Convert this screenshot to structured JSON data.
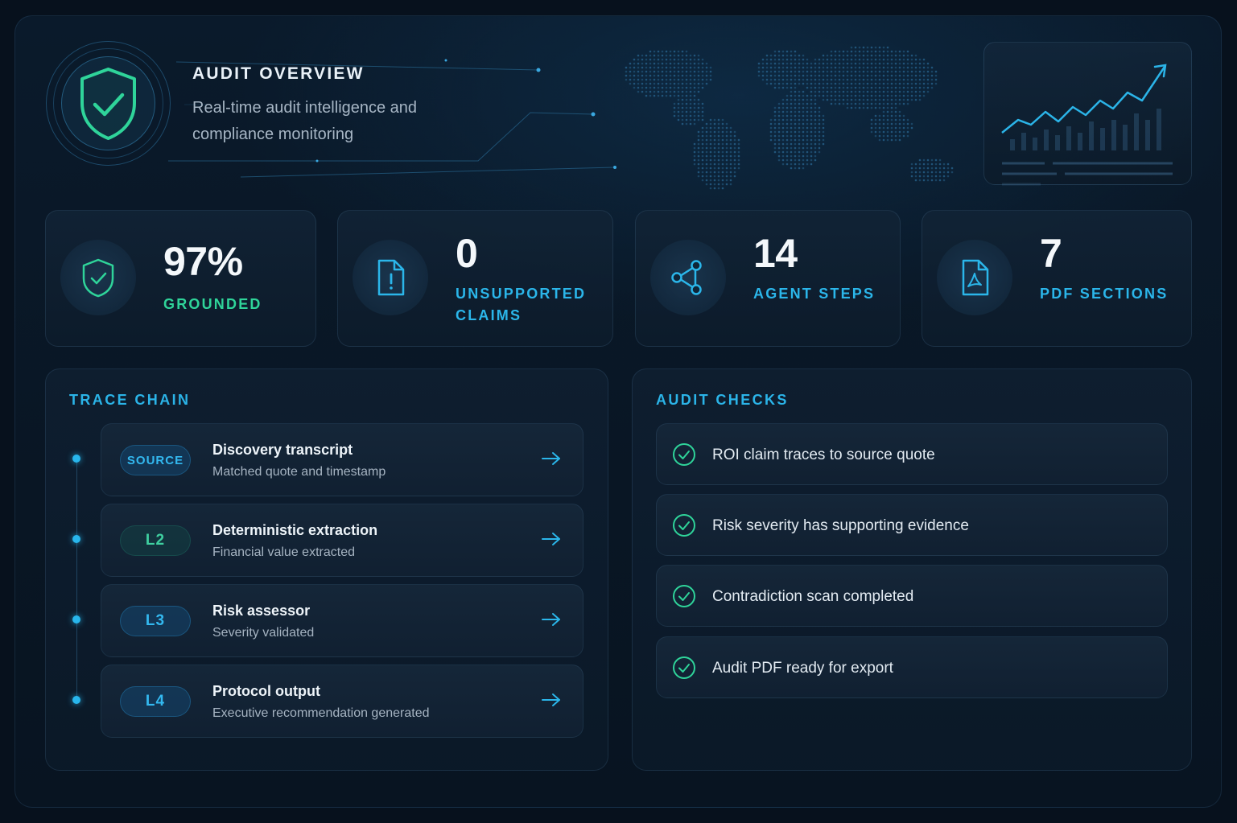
{
  "header": {
    "title": "AUDIT OVERVIEW",
    "subtitle": "Real-time audit intelligence and compliance monitoring"
  },
  "stats": [
    {
      "value": "97%",
      "label": "GROUNDED",
      "icon": "shield-check-icon",
      "color": "#2fd49a"
    },
    {
      "value": "0",
      "label": "UNSUPPORTED CLAIMS",
      "icon": "document-alert-icon",
      "color": "#2bb6ea"
    },
    {
      "value": "14",
      "label": "AGENT STEPS",
      "icon": "network-nodes-icon",
      "color": "#2bb6ea"
    },
    {
      "value": "7",
      "label": "PDF SECTIONS",
      "icon": "pdf-file-icon",
      "color": "#2bb6ea"
    }
  ],
  "trace_chain": {
    "title": "TRACE CHAIN",
    "steps": [
      {
        "tag": "SOURCE",
        "name": "Discovery transcript",
        "desc": "Matched quote and timestamp"
      },
      {
        "tag": "L2",
        "name": "Deterministic extraction",
        "desc": "Financial value extracted"
      },
      {
        "tag": "L3",
        "name": "Risk assessor",
        "desc": "Severity validated"
      },
      {
        "tag": "L4",
        "name": "Protocol output",
        "desc": "Executive recommendation generated"
      }
    ]
  },
  "audit_checks": {
    "title": "AUDIT CHECKS",
    "items": [
      "ROI claim traces to source quote",
      "Risk severity has supporting evidence",
      "Contradiction scan completed",
      "Audit PDF ready for export"
    ]
  },
  "colors": {
    "accent_blue": "#2bb4e8",
    "accent_green": "#2fd49a",
    "background": "#07111d"
  }
}
